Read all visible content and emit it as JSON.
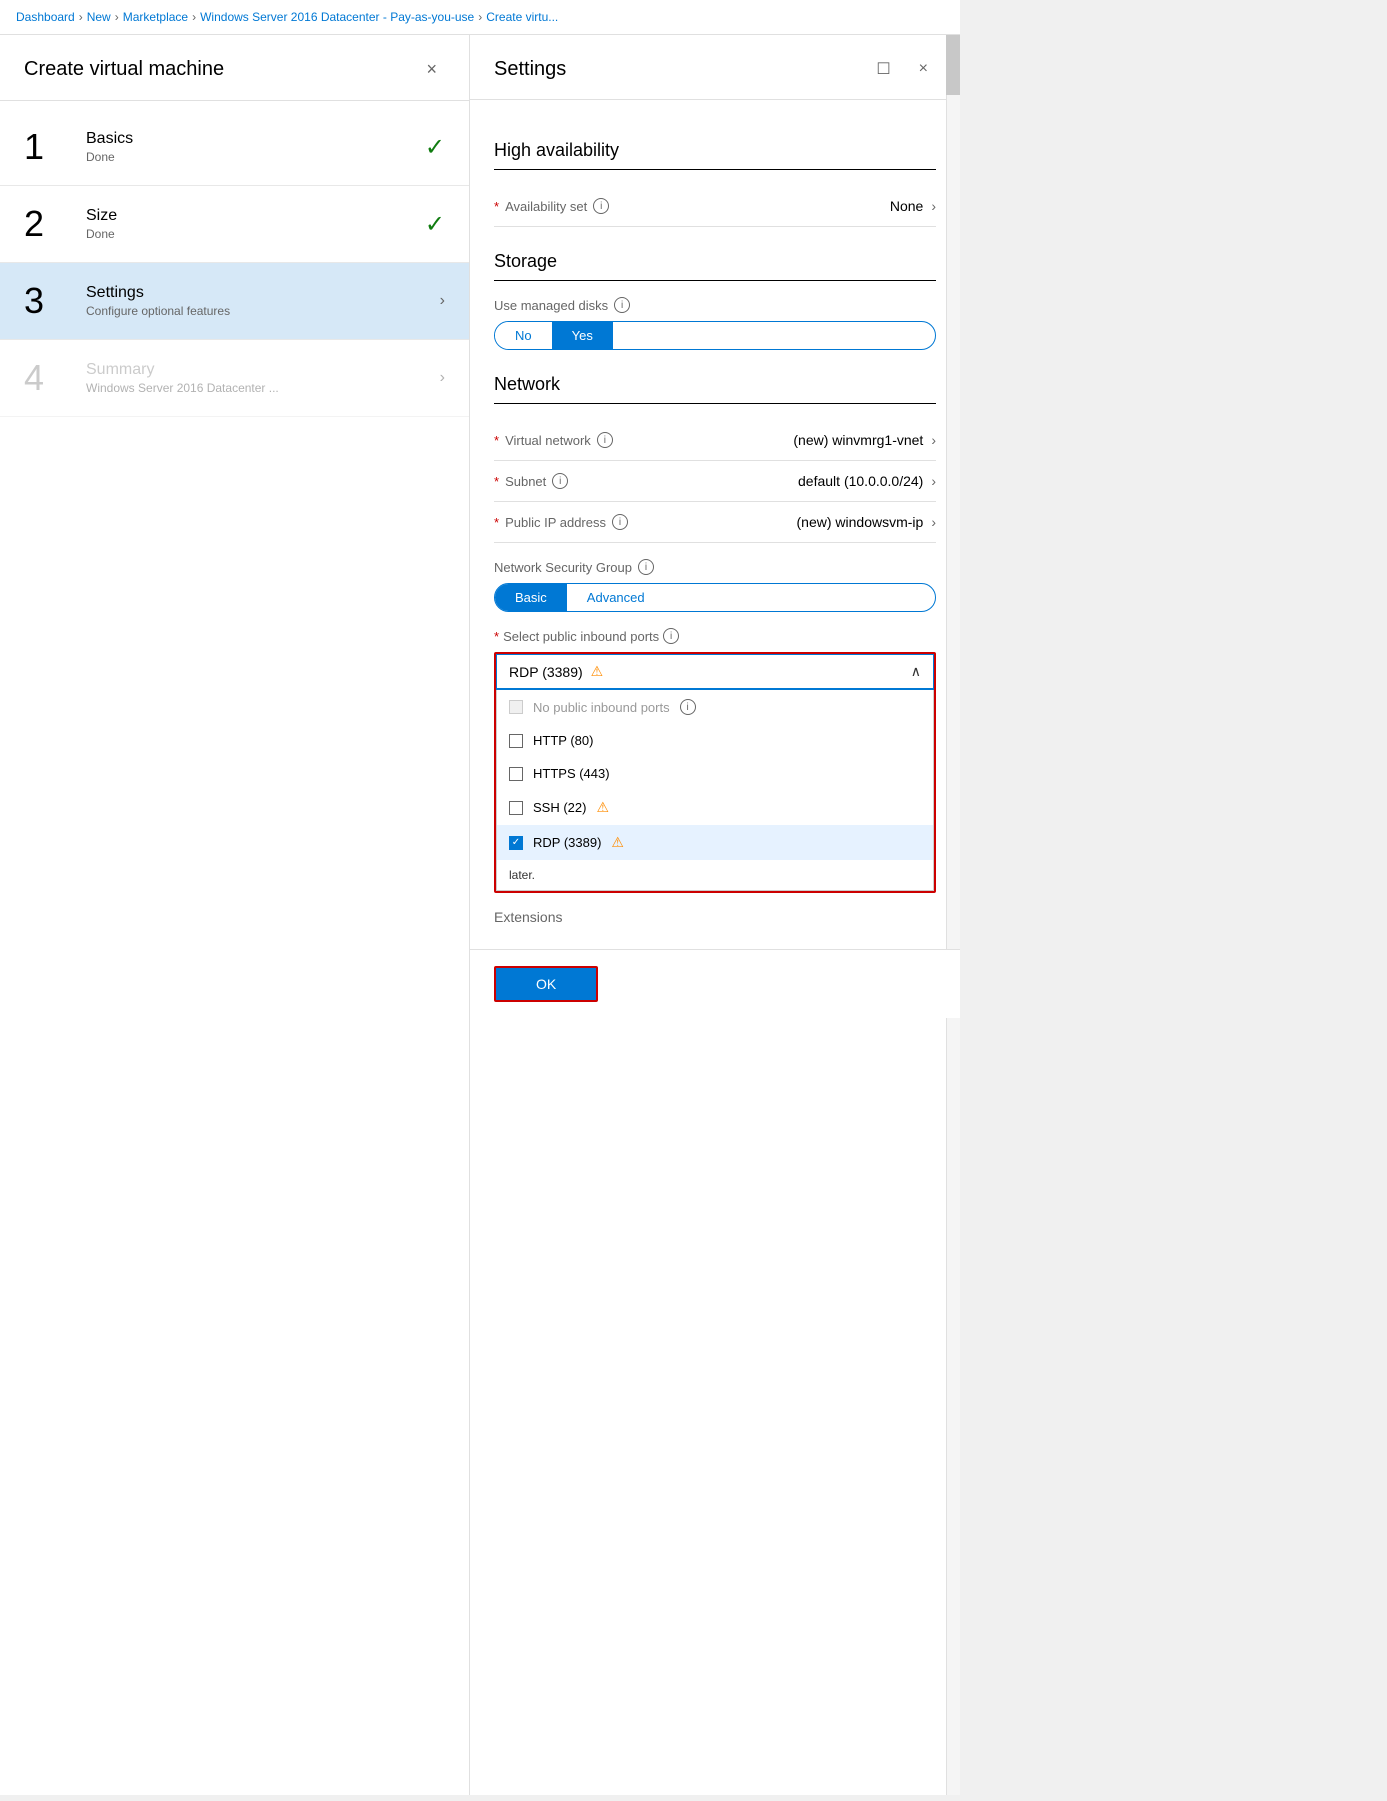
{
  "breadcrumb": {
    "items": [
      {
        "label": "Dashboard",
        "sep": false
      },
      {
        "label": "New",
        "sep": true
      },
      {
        "label": "Marketplace",
        "sep": true
      },
      {
        "label": "Windows Server 2016 Datacenter - Pay-as-you-use",
        "sep": true
      },
      {
        "label": "Create virtu...",
        "sep": true
      }
    ]
  },
  "left_panel": {
    "title": "Create virtual machine",
    "close_label": "×",
    "steps": [
      {
        "number": "1",
        "title": "Basics",
        "subtitle": "Done",
        "status": "done",
        "active": false,
        "disabled": false
      },
      {
        "number": "2",
        "title": "Size",
        "subtitle": "Done",
        "status": "done",
        "active": false,
        "disabled": false
      },
      {
        "number": "3",
        "title": "Settings",
        "subtitle": "Configure optional features",
        "status": "active",
        "active": true,
        "disabled": false
      },
      {
        "number": "4",
        "title": "Summary",
        "subtitle": "Windows Server 2016 Datacenter ...",
        "status": "pending",
        "active": false,
        "disabled": true
      }
    ]
  },
  "right_panel": {
    "title": "Settings",
    "sections": {
      "high_availability": {
        "title": "High availability",
        "availability_set": {
          "label": "Availability set",
          "required": true,
          "value": "None",
          "has_info": true
        }
      },
      "storage": {
        "title": "Storage",
        "managed_disks": {
          "label": "Use managed disks",
          "has_info": true,
          "options": [
            "No",
            "Yes"
          ],
          "selected": "Yes"
        }
      },
      "network": {
        "title": "Network",
        "virtual_network": {
          "label": "Virtual network",
          "required": true,
          "value": "(new) winvmrg1-vnet",
          "has_info": true
        },
        "subnet": {
          "label": "Subnet",
          "required": true,
          "value": "default (10.0.0.0/24)",
          "has_info": true
        },
        "public_ip": {
          "label": "Public IP address",
          "required": true,
          "value": "(new) windowsvm-ip",
          "has_info": true
        }
      },
      "nsg": {
        "label": "Network Security Group",
        "has_info": true,
        "options": [
          "Basic",
          "Advanced"
        ],
        "selected": "Basic"
      },
      "inbound_ports": {
        "label": "Select public inbound ports",
        "has_info": true,
        "selected_value": "RDP (3389)",
        "has_warning": true,
        "dropdown_open": true,
        "options": [
          {
            "id": "none",
            "label": "No public inbound ports",
            "checked": false,
            "disabled": true,
            "has_info": true
          },
          {
            "id": "http",
            "label": "HTTP (80)",
            "checked": false,
            "disabled": false
          },
          {
            "id": "https",
            "label": "HTTPS (443)",
            "checked": false,
            "disabled": false
          },
          {
            "id": "ssh",
            "label": "SSH (22)",
            "checked": false,
            "disabled": false,
            "has_warning": true
          },
          {
            "id": "rdp",
            "label": "RDP (3389)",
            "checked": true,
            "disabled": false,
            "has_warning": true,
            "selected": true
          }
        ],
        "later_text": "later."
      }
    },
    "extensions_label": "Extensions",
    "ok_label": "OK"
  }
}
